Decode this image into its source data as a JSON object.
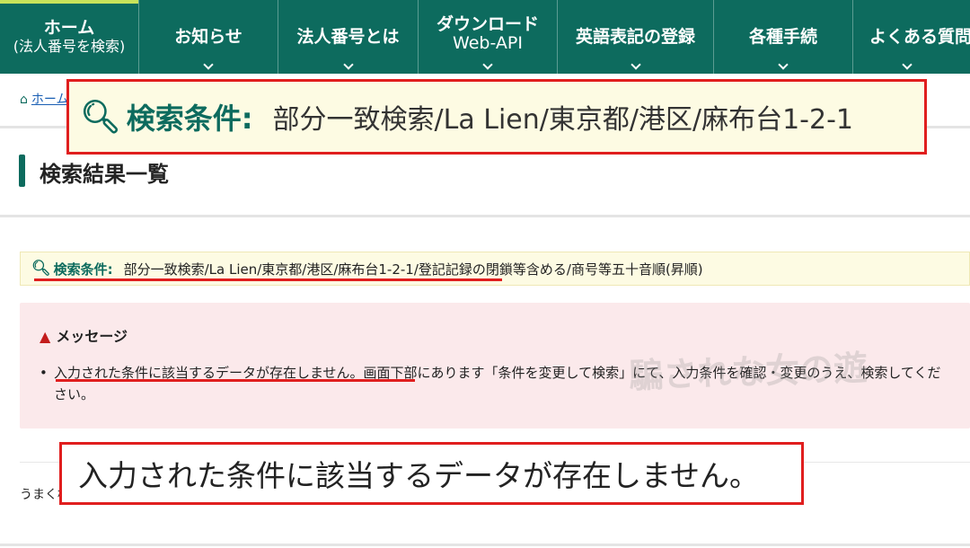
{
  "nav": {
    "items": [
      {
        "label": "ホーム",
        "sub": "(法人番号を検索)"
      },
      {
        "label": "お知らせ"
      },
      {
        "label": "法人番号とは"
      },
      {
        "label": "ダウンロード",
        "sub": "Web-API"
      },
      {
        "label": "英語表記の登録"
      },
      {
        "label": "各種手続"
      },
      {
        "label": "よくある質問"
      }
    ],
    "colors": {
      "background": "#0d6b5e",
      "accent": "#c8e35a"
    }
  },
  "breadcrumb": {
    "home_label": "ホーム"
  },
  "heading": {
    "title": "検索結果一覧"
  },
  "callout_condition": {
    "label": "検索条件:",
    "value": "部分一致検索/La Lien/東京都/港区/麻布台1-2-1"
  },
  "condition": {
    "label": "検索条件:",
    "value": "部分一致検索/La Lien/東京都/港区/麻布台1-2-1/登記記録の閉鎖等含める/商号等五十音順(昇順)"
  },
  "message": {
    "title": "メッセージ",
    "body": "入力された条件に該当するデータが存在しません。画面下部にあります「条件を変更して検索」にて、入力条件を確認・変更のうえ、検索してください。"
  },
  "watermark": "騙されな女の遊",
  "result_note": "うまく検",
  "callout_message": "入力された条件に該当するデータが存在しません。",
  "colors": {
    "brand": "#0d6b5e",
    "highlight": "#e01e1e",
    "condition_bg": "#fdfbe3",
    "message_bg": "#fbe9eb"
  }
}
